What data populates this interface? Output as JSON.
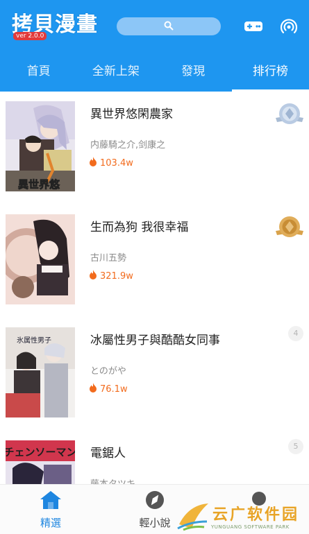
{
  "app": {
    "logo_text": "拷貝漫畫",
    "version": "ver 2.0.0"
  },
  "header_icons": [
    "search-icon",
    "gamepad-icon",
    "broadcast-icon"
  ],
  "tabs": [
    {
      "label": "首頁"
    },
    {
      "label": "全新上架"
    },
    {
      "label": "發現"
    },
    {
      "label": "排行榜",
      "active": true
    }
  ],
  "rankings": [
    {
      "rank": "1",
      "title": "異世界悠閑農家",
      "author": "内藤騎之介,剑康之",
      "heat": "103.4w",
      "badge": "silver-medal",
      "cover_text": "異世界悠"
    },
    {
      "rank": "2",
      "title": "生而為狗 我很幸福",
      "author": "古川五勢",
      "heat": "321.9w",
      "badge": "bronze-medal",
      "cover_text": ""
    },
    {
      "rank": "4",
      "title": "冰屬性男子與酷酷女同事",
      "author": "とのがや",
      "heat": "76.1w",
      "badge": "number",
      "cover_text": "氷属性男子"
    },
    {
      "rank": "5",
      "title": "電鋸人",
      "author": "",
      "heat": "",
      "badge": "number",
      "cover_text": "チェンソーマン"
    }
  ],
  "partial_author": "藤本タツキ",
  "bottom_nav": [
    {
      "label": "精選",
      "icon": "home-icon",
      "active": true
    },
    {
      "label": "輕小說",
      "icon": "compass-icon",
      "active": false
    },
    {
      "label": "",
      "icon": "user-icon",
      "active": false
    }
  ],
  "watermark": {
    "text": "云广软件园",
    "sub": "YUNGUANG SOFTWARE PARK"
  },
  "colors": {
    "primary": "#1e96f0",
    "heat": "#f26b1d",
    "nav_active": "#1e86e0"
  }
}
